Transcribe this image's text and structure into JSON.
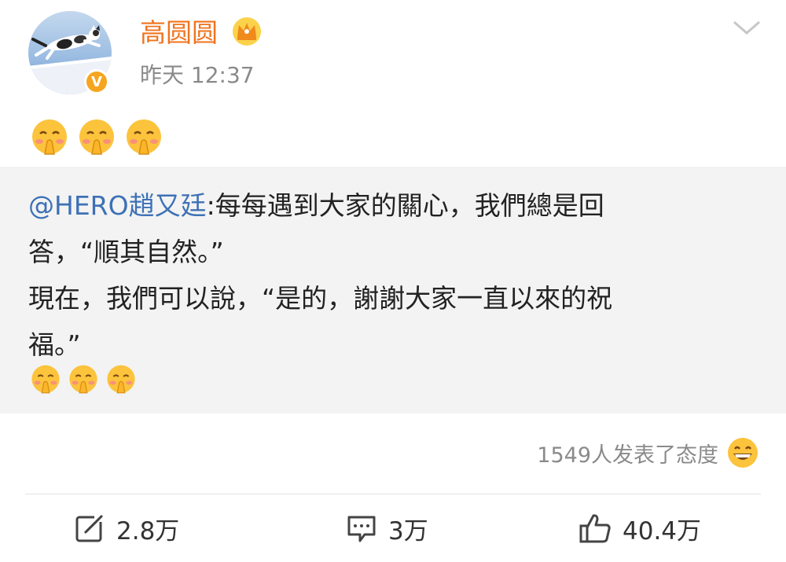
{
  "post": {
    "username": "高圆圆",
    "time": "昨天 12:37",
    "verified_mark": "V",
    "badge_icon": "crown-icon",
    "menu_icon": "chevron-down-icon"
  },
  "content": {
    "emoji_icon": "praying-face-emoji",
    "emoji_count": 3
  },
  "repost": {
    "mention": "@HERO趙又廷",
    "text": ":每每遇到大家的關心，我們總是回\n答，“順其自然。”\n現在，我們可以說，“是的，謝謝大家一直以來的祝\n福。”",
    "emoji_count": 3
  },
  "reactions": {
    "text": "1549人发表了态度",
    "icon": "grinning-face-emoji"
  },
  "actions": {
    "repost_count": "2.8万",
    "comment_count": "3万",
    "like_count": "40.4万",
    "repost_icon": "share-edit-icon",
    "comment_icon": "comment-icon",
    "like_icon": "thumbs-up-icon"
  },
  "colors": {
    "username": "#f0731e",
    "mention": "#3d71b6",
    "verified": "#f6a51e",
    "repost_bg": "#f3f3f3"
  }
}
